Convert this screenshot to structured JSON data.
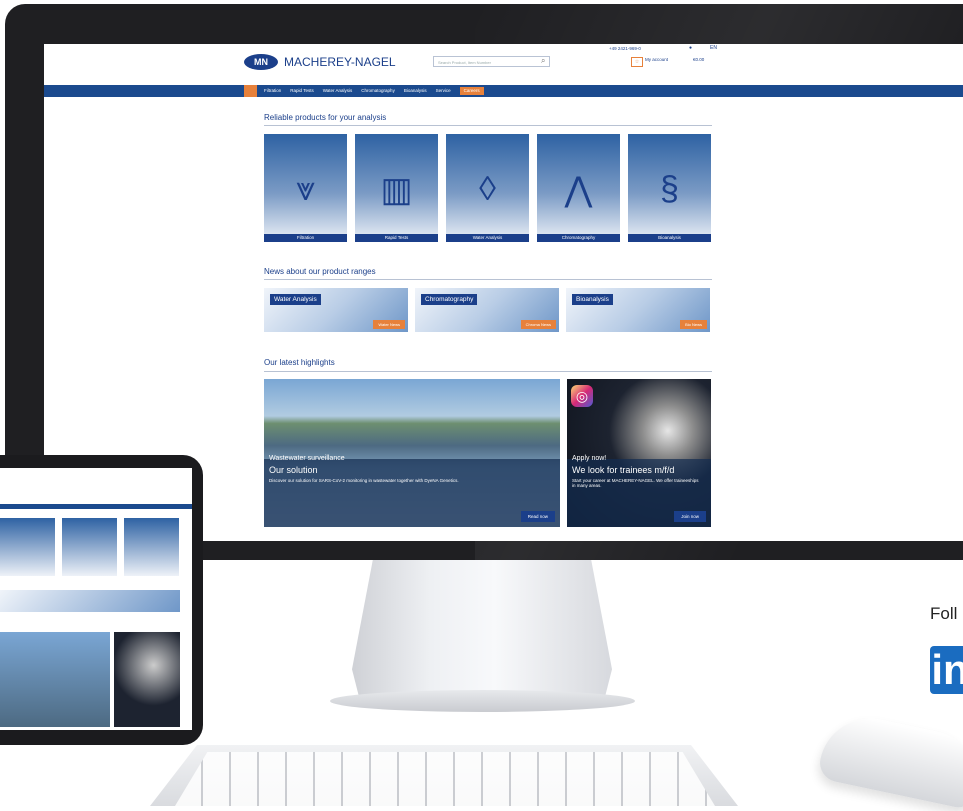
{
  "site": {
    "brand": "MACHEREY-NAGEL",
    "logo_mark": "MN",
    "search_placeholder": "Search Product, Item Number",
    "phone": "+49 2421-969-0",
    "language": "EN",
    "account": "My account",
    "cart": "€0.00",
    "nav": [
      "Filtration",
      "Rapid Tests",
      "Water Analysis",
      "Chromatography",
      "Bioanalysis",
      "Service",
      "Careers"
    ],
    "section_products": "Reliable products for your analysis",
    "products": [
      "Filtration",
      "Rapid Tests",
      "Water Analysis",
      "Chromatography",
      "Bioanalysis"
    ],
    "section_news": "News about our product ranges",
    "news": [
      {
        "title": "Water Analysis",
        "button": "Water News"
      },
      {
        "title": "Chromatography",
        "button": "Chroma News"
      },
      {
        "title": "Bioanalysis",
        "button": "Bio News"
      }
    ],
    "section_highlights": "Our latest highlights",
    "highlight_main": {
      "kicker": "Wastewater surveillance",
      "title": "Our solution",
      "text": "Discover our solution for SARS-CoV-2 monitoring in wastewater together with DyeNA Genetics.",
      "button": "Read now"
    },
    "highlight_side": {
      "kicker": "Apply now!",
      "title": "We look for trainees m/f/d",
      "text": "Start your career at MACHEREY-NAGEL. We offer traineeships in many areas.",
      "button": "Join now"
    }
  },
  "follow": "Foll",
  "linkedin": "in"
}
